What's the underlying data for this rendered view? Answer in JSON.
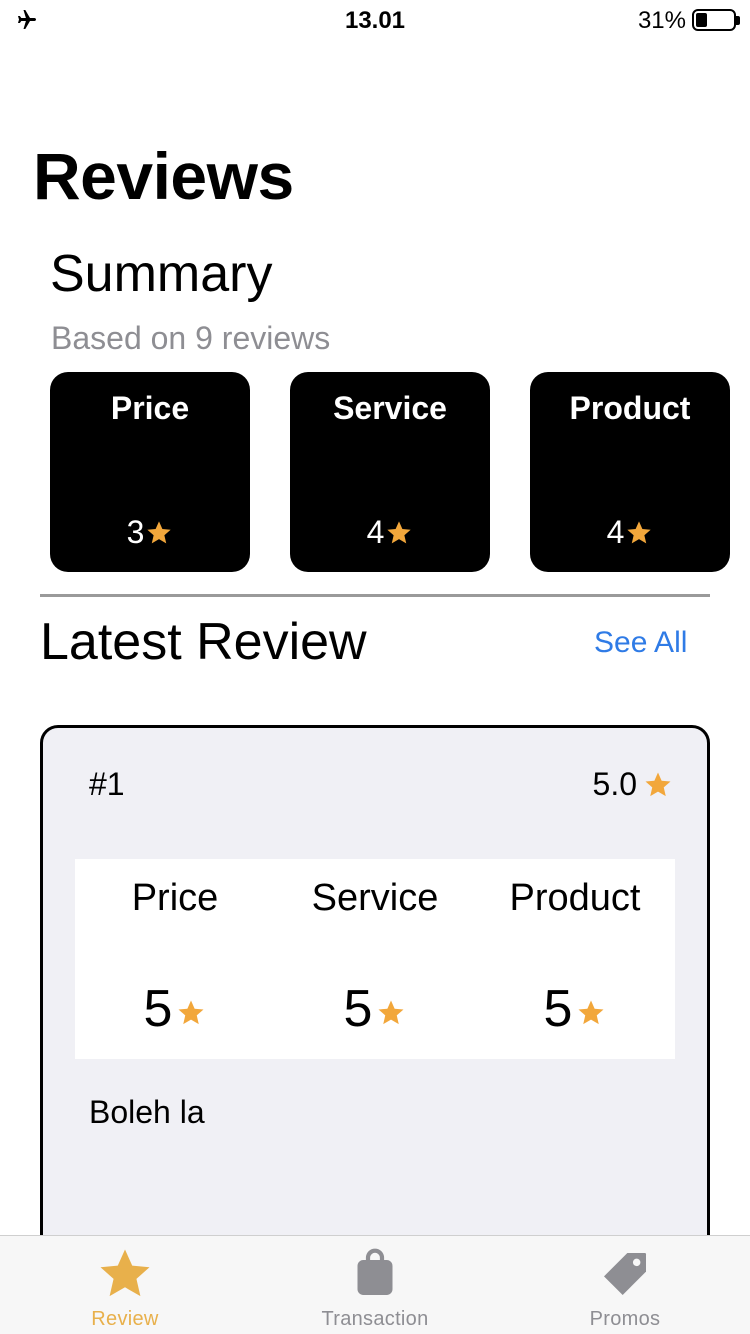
{
  "status_bar": {
    "time": "13.01",
    "battery_percent": "31%",
    "battery_level": 0.31
  },
  "page_title": "Reviews",
  "summary": {
    "title": "Summary",
    "subtitle": "Based on 9 reviews",
    "cards": [
      {
        "label": "Price",
        "score": "3"
      },
      {
        "label": "Service",
        "score": "4"
      },
      {
        "label": "Product",
        "score": "4"
      }
    ]
  },
  "latest": {
    "title": "Latest Review",
    "see_all": "See All",
    "review": {
      "number": "#1",
      "overall": "5.0",
      "categories": [
        {
          "label": "Price",
          "score": "5"
        },
        {
          "label": "Service",
          "score": "5"
        },
        {
          "label": "Product",
          "score": "5"
        }
      ],
      "text": "Boleh la"
    }
  },
  "tab_bar": {
    "tabs": [
      {
        "label": "Review",
        "icon": "star-icon",
        "active": true
      },
      {
        "label": "Transaction",
        "icon": "bag-icon",
        "active": false
      },
      {
        "label": "Promos",
        "icon": "tag-icon",
        "active": false
      }
    ]
  },
  "colors": {
    "accent": "#e8b04b",
    "star": "#f2a73b",
    "link": "#2f7be6",
    "inactive": "#8e8e93"
  }
}
